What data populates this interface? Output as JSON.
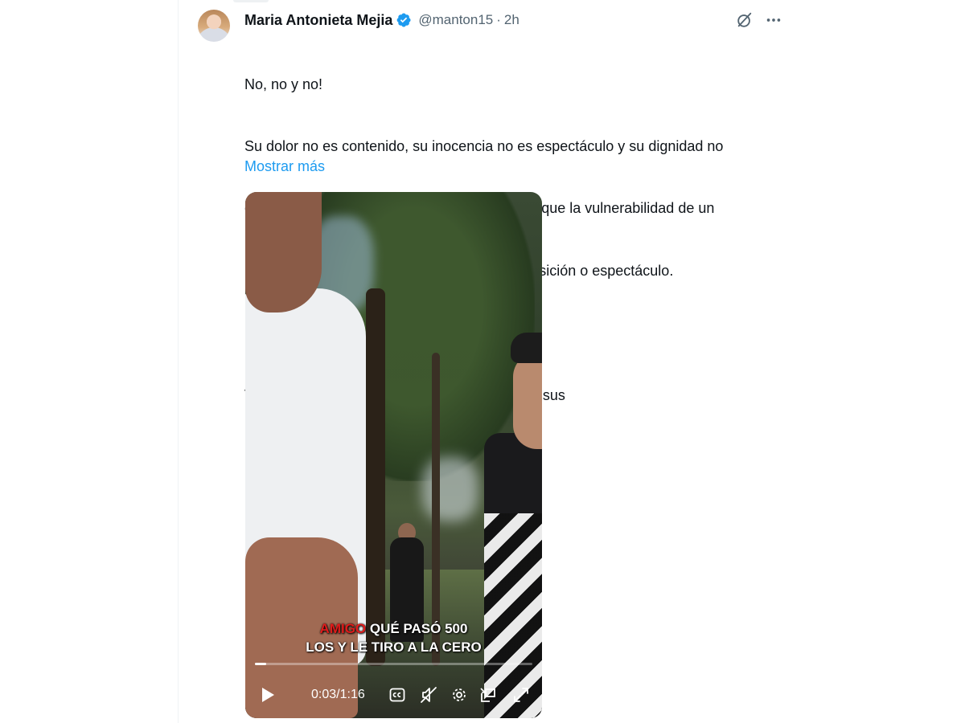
{
  "tweet": {
    "author_name": "Maria Antonieta Mejia",
    "handle": "@manton15",
    "separator": "·",
    "time": "2h",
    "text_lines": [
      "No, no y no!",
      "Su dolor no es contenido, su inocencia no es espectáculo y su dignidad no",
      "está en discusión. Este Gobierno no permitirá que la vulnerabilidad de un",
      "niño sea utilizada como entretenimiento, exposición o espectáculo.",
      "",
      "Vamos a proteger su dignidad, su integridad y sus"
    ],
    "show_more": "Mostrar más"
  },
  "video": {
    "caption_line1_red": "AMIGO",
    "caption_line1_rest": " QUÉ PASÓ 500",
    "caption_line2": "LOS Y LE TIRO A LA CERO",
    "current_time": "0:03",
    "time_sep": " / ",
    "duration": "1:16",
    "progress_fraction": 0.04
  },
  "icons": {
    "verified": "verified-badge-icon",
    "grok": "grok-icon",
    "more": "more-icon",
    "play": "play-icon",
    "cc": "captions-icon",
    "mute": "muted-icon",
    "settings": "settings-icon",
    "pip": "picture-in-picture-icon",
    "fullscreen": "fullscreen-icon"
  },
  "colors": {
    "link": "#1d9bf0",
    "secondary_text": "#536471",
    "caption_accent": "#e01b1b"
  }
}
